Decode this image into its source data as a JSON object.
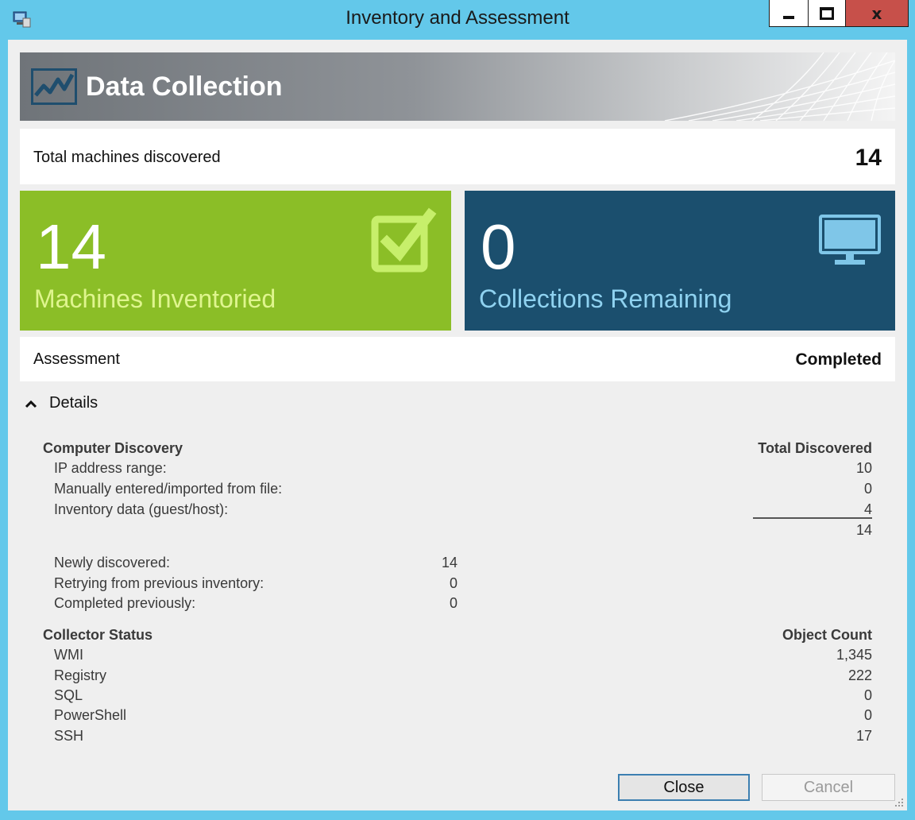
{
  "window": {
    "title": "Inventory and Assessment",
    "close_glyph": "x",
    "icon": "app-computer-icon"
  },
  "banner": {
    "title": "Data Collection",
    "icon": "chart-line-icon"
  },
  "summary": {
    "total_label": "Total machines discovered",
    "total_value": "14"
  },
  "tiles": {
    "inventoried": {
      "number": "14",
      "caption": "Machines Inventoried",
      "icon": "checkbox-checked-icon",
      "color": "#8bbe27"
    },
    "remaining": {
      "number": "0",
      "caption": "Collections Remaining",
      "icon": "monitor-icon",
      "color": "#1b4f6e"
    }
  },
  "assessment": {
    "label": "Assessment",
    "status": "Completed"
  },
  "details": {
    "toggle_label": "Details",
    "computer_discovery": {
      "title": "Computer Discovery",
      "column_header": "Total Discovered",
      "rows": [
        {
          "label": "IP address range:",
          "value": "10"
        },
        {
          "label": "Manually entered/imported from file:",
          "value": "0"
        },
        {
          "label": "Inventory data (guest/host):",
          "value": "4"
        }
      ],
      "total": "14"
    },
    "progress": {
      "rows": [
        {
          "label": "Newly discovered:",
          "value": "14"
        },
        {
          "label": "Retrying from previous inventory:",
          "value": "0"
        },
        {
          "label": "Completed previously:",
          "value": "0"
        }
      ]
    },
    "collector_status": {
      "title": "Collector Status",
      "column_header": "Object Count",
      "rows": [
        {
          "label": "WMI",
          "value": "1,345"
        },
        {
          "label": "Registry",
          "value": "222"
        },
        {
          "label": "SQL",
          "value": "0"
        },
        {
          "label": "PowerShell",
          "value": "0"
        },
        {
          "label": "SSH",
          "value": "17"
        }
      ]
    }
  },
  "buttons": {
    "close": "Close",
    "cancel": "Cancel"
  }
}
